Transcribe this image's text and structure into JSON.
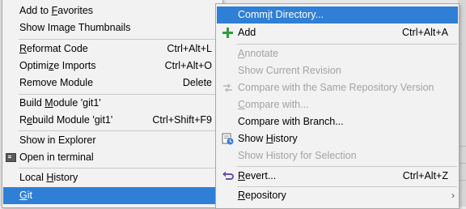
{
  "main_menu": {
    "items": [
      {
        "pre": "Add to ",
        "u": "F",
        "post": "avorites",
        "shortcut": "",
        "arrow": "›"
      },
      {
        "pre": "Show Image Thumbnails",
        "u": "",
        "post": "",
        "shortcut": ""
      },
      {
        "pre": "",
        "u": "R",
        "post": "eformat Code",
        "shortcut": "Ctrl+Alt+L"
      },
      {
        "pre": "Optimi",
        "u": "z",
        "post": "e Imports",
        "shortcut": "Ctrl+Alt+O"
      },
      {
        "pre": "Remove Module",
        "u": "",
        "post": "",
        "shortcut": "Delete"
      },
      {
        "pre": "Build ",
        "u": "M",
        "post": "odule 'git1'",
        "shortcut": ""
      },
      {
        "pre": "R",
        "u": "e",
        "post": "build Module 'git1'",
        "shortcut": "Ctrl+Shift+F9"
      },
      {
        "pre": "Show in Explorer",
        "u": "",
        "post": "",
        "shortcut": ""
      },
      {
        "pre": "Open in terminal",
        "u": "",
        "post": "",
        "shortcut": ""
      },
      {
        "pre": "Local ",
        "u": "H",
        "post": "istory",
        "shortcut": "",
        "arrow": "›"
      },
      {
        "pre": "",
        "u": "G",
        "post": "it",
        "shortcut": "",
        "arrow": "›"
      }
    ]
  },
  "git_menu": {
    "items": [
      {
        "pre": "Comm",
        "u": "i",
        "post": "t Directory...",
        "shortcut": ""
      },
      {
        "pre": "Add",
        "u": "",
        "post": "",
        "shortcut": "Ctrl+Alt+A"
      },
      {
        "pre": "",
        "u": "A",
        "post": "nnotate",
        "shortcut": ""
      },
      {
        "pre": "Show Current Revision",
        "u": "",
        "post": "",
        "shortcut": ""
      },
      {
        "pre": "Compare with the Same Repository Version",
        "u": "",
        "post": "",
        "shortcut": ""
      },
      {
        "pre": "",
        "u": "C",
        "post": "ompare with...",
        "shortcut": ""
      },
      {
        "pre": "Compare with Branch...",
        "u": "",
        "post": "",
        "shortcut": ""
      },
      {
        "pre": "Show ",
        "u": "H",
        "post": "istory",
        "shortcut": ""
      },
      {
        "pre": "Show History for Selection",
        "u": "",
        "post": "",
        "shortcut": ""
      },
      {
        "pre": "",
        "u": "R",
        "post": "evert...",
        "shortcut": "Ctrl+Alt+Z"
      },
      {
        "pre": "",
        "u": "R",
        "post": "epository",
        "shortcut": "",
        "arrow": "›"
      }
    ]
  },
  "colors": {
    "selection": "#2f7fd6",
    "disabled_text": "#a3a3a3",
    "add_icon": "#2e9e3e",
    "revert_icon": "#6a4fb0"
  },
  "icons": {
    "add": "plus-icon",
    "history": "history-icon",
    "revert": "revert-icon",
    "image_thumbnails": "image-icon",
    "terminal": "terminal-icon"
  }
}
